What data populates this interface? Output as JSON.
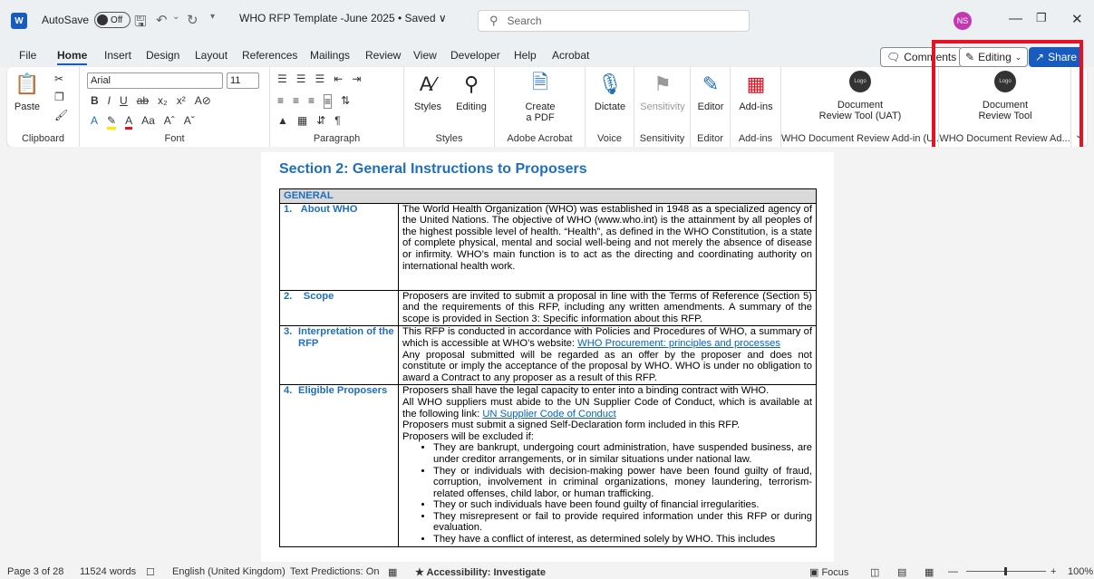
{
  "titlebar": {
    "autosave": "AutoSave",
    "toggle_state": "Off",
    "doc_title": "WHO RFP Template -June 2025 • Saved ∨",
    "search_placeholder": "Search",
    "avatar_initials": "NS"
  },
  "menu": {
    "items": [
      "File",
      "Home",
      "Insert",
      "Design",
      "Layout",
      "References",
      "Mailings",
      "Review",
      "View",
      "Developer",
      "Help",
      "Acrobat"
    ],
    "comments": "Comments",
    "editing": "Editing",
    "share": "Share"
  },
  "ribbon": {
    "font_name": "Arial",
    "font_size": "11",
    "paste": "Paste",
    "styles": "Styles",
    "editing": "Editing",
    "create_pdf": "Create\na PDF",
    "dictate": "Dictate",
    "sensitivity": "Sensitivity",
    "editor": "Editor",
    "addins": "Add-ins",
    "logo": "Logo",
    "doc_review_uat": "Document\nReview Tool (UAT)",
    "doc_review": "Document\nReview Tool",
    "groups": {
      "clipboard": "Clipboard",
      "font": "Font",
      "paragraph": "Paragraph",
      "styles": "Styles",
      "adobe": "Adobe Acrobat",
      "voice": "Voice",
      "sensitivity": "Sensitivity",
      "editor": "Editor",
      "addins": "Add-ins",
      "who_uat": "WHO Document Review Add-in (U...",
      "who": "WHO Document Review Ad..."
    }
  },
  "document": {
    "heading": "Section 2: General Instructions to Proposers",
    "table_header": "GENERAL",
    "rows": [
      {
        "num": "1.",
        "label": "About WHO",
        "text": "The World Health Organization (WHO) was established in 1948 as a specialized agency of the United Nations. The objective of WHO (www.who.int) is the attainment by all peoples of the highest possible level of health. “Health”, as defined in the WHO Constitution, is a state of complete physical, mental and social well-being and not merely the absence of disease or infirmity. WHO’s main function is to act as the directing and coordinating authority on international health work."
      },
      {
        "num": "2.",
        "label": "Scope",
        "text": "Proposers are invited to submit a proposal in line with the Terms of Reference (Section 5) and the requirements of this RFP, including any written amendments. A summary of the scope is provided in Section 3: Specific information about this RFP."
      },
      {
        "num": "3.",
        "label": "Interpretation of the RFP",
        "text_a": "This RFP is conducted in accordance with Policies and Procedures of WHO, a summary of which is accessible at WHO’s website: ",
        "link": "WHO Procurement: principles and processes",
        "text_b": "Any proposal submitted will be regarded as an offer by the proposer and does not constitute or imply the acceptance of the proposal by WHO. WHO is under no obligation to award a Contract to any proposer as a result of this RFP."
      },
      {
        "num": "4.",
        "label": "Eligible Proposers",
        "line1": "Proposers shall have the legal capacity to enter into a binding contract with WHO.",
        "line2a": "All WHO suppliers must abide to the UN Supplier Code of Conduct, which is available at the following link: ",
        "link": "UN Supplier Code of Conduct",
        "line3": "Proposers must submit a signed Self-Declaration form included in this RFP.",
        "line4": "Proposers will be excluded if:",
        "bullets": [
          "They are bankrupt, undergoing court administration, have suspended business, are under creditor arrangements, or in similar situations under national law.",
          "They or individuals with decision-making power have been found guilty of fraud, corruption, involvement in criminal organizations, money laundering, terrorism-related offenses, child labor, or human trafficking.",
          "They or such individuals have been found guilty of financial irregularities.",
          "They misrepresent or fail to provide required information under this RFP or during evaluation.",
          "They have a conflict of interest, as determined solely by WHO. This includes"
        ]
      }
    ]
  },
  "status": {
    "page": "Page 3 of 28",
    "words": "11524 words",
    "language": "English (United Kingdom)",
    "predictions": "Text Predictions: On",
    "accessibility": "Accessibility: Investigate",
    "focus": "Focus",
    "zoom": "100%"
  }
}
